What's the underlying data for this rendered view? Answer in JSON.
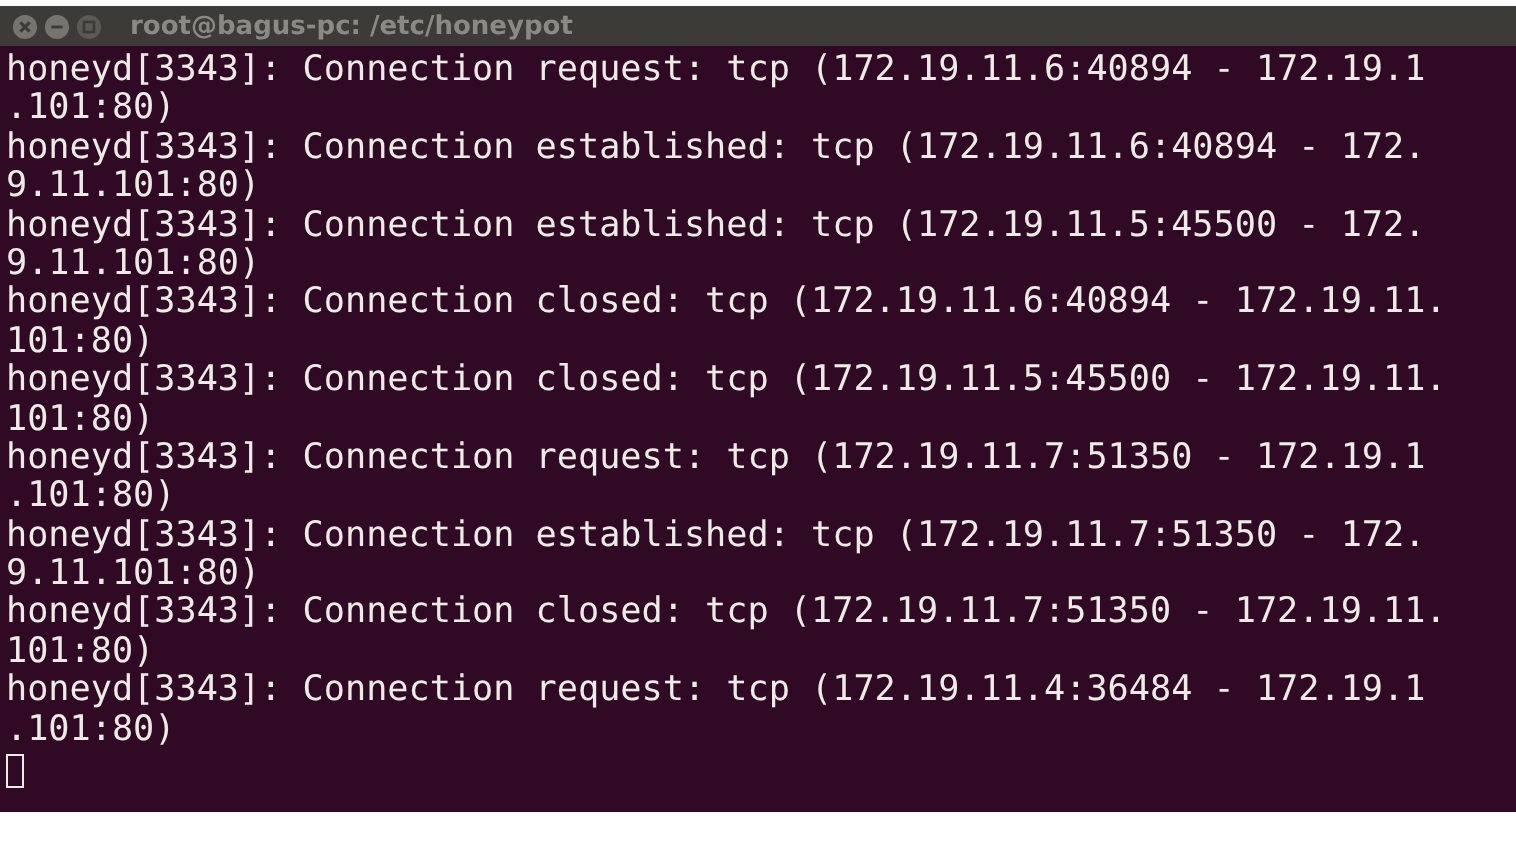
{
  "window": {
    "title": "root@bagus-pc: /etc/honeypot"
  },
  "terminal": {
    "lines": [
      "honeyd[3343]: Connection request: tcp (172.19.11.6:40894 - 172.19.1",
      ".101:80)",
      "honeyd[3343]: Connection established: tcp (172.19.11.6:40894 - 172.",
      "9.11.101:80)",
      "honeyd[3343]: Connection established: tcp (172.19.11.5:45500 - 172.",
      "9.11.101:80)",
      "honeyd[3343]: Connection closed: tcp (172.19.11.6:40894 - 172.19.11.",
      "101:80)",
      "honeyd[3343]: Connection closed: tcp (172.19.11.5:45500 - 172.19.11.",
      "101:80)",
      "honeyd[3343]: Connection request: tcp (172.19.11.7:51350 - 172.19.1",
      ".101:80)",
      "honeyd[3343]: Connection established: tcp (172.19.11.7:51350 - 172.",
      "9.11.101:80)",
      "honeyd[3343]: Connection closed: tcp (172.19.11.7:51350 - 172.19.11.",
      "101:80)",
      "honeyd[3343]: Connection request: tcp (172.19.11.4:36484 - 172.19.1",
      ".101:80)"
    ],
    "cursor": {
      "visible": true
    }
  }
}
